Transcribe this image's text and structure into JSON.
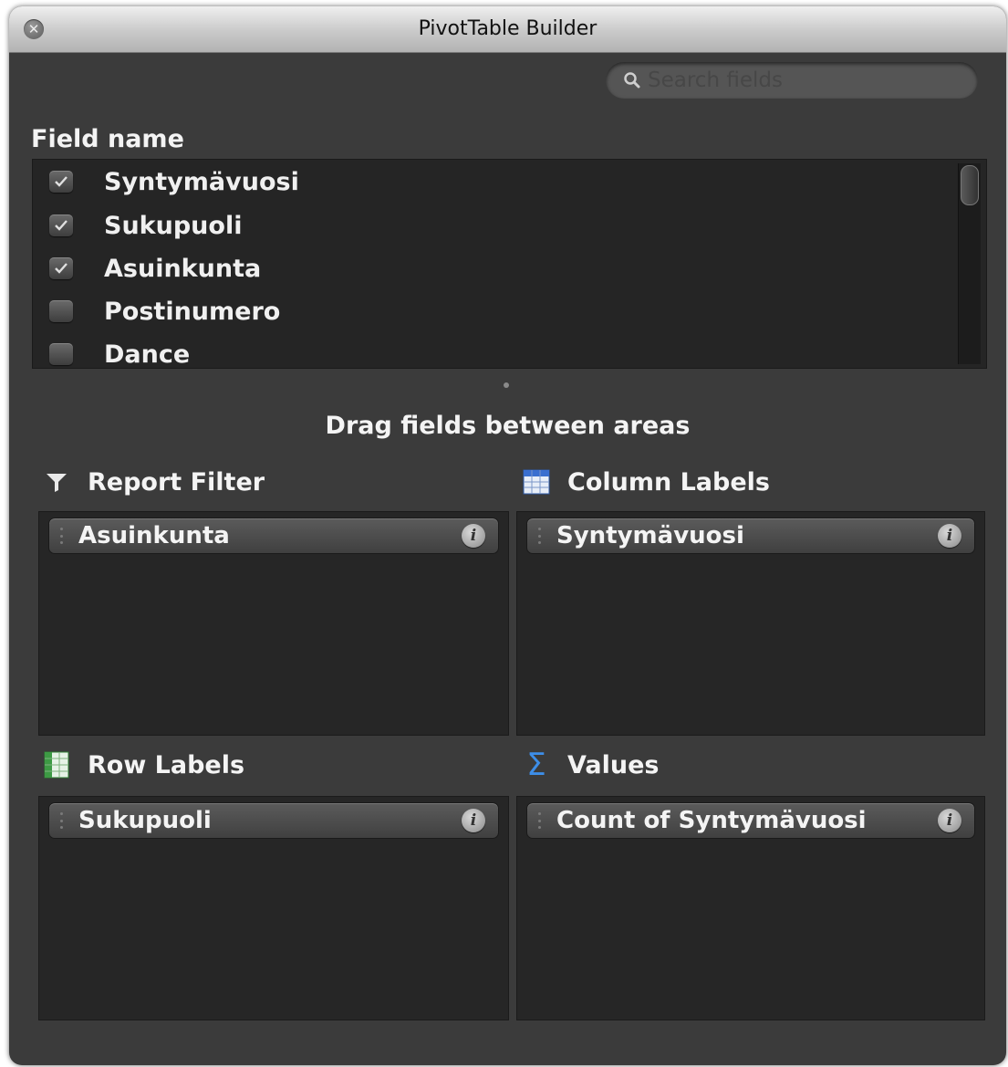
{
  "window": {
    "title": "PivotTable Builder",
    "close_icon": "close-icon"
  },
  "search": {
    "placeholder": "Search fields",
    "value": ""
  },
  "field_list": {
    "heading": "Field name",
    "items": [
      {
        "label": "Syntymävuosi",
        "checked": true
      },
      {
        "label": "Sukupuoli",
        "checked": true
      },
      {
        "label": "Asuinkunta",
        "checked": true
      },
      {
        "label": "Postinumero",
        "checked": false
      },
      {
        "label": "Dance",
        "checked": false
      }
    ]
  },
  "drag_heading": "Drag fields between areas",
  "areas": {
    "report_filter": {
      "label": "Report Filter",
      "icon": "filter-icon",
      "fields": [
        "Asuinkunta"
      ]
    },
    "column_labels": {
      "label": "Column Labels",
      "icon": "column-labels-icon",
      "fields": [
        "Syntymävuosi"
      ]
    },
    "row_labels": {
      "label": "Row Labels",
      "icon": "row-labels-icon",
      "fields": [
        "Sukupuoli"
      ]
    },
    "values": {
      "label": "Values",
      "icon": "sigma-icon",
      "fields": [
        "Count of Syntymävuosi"
      ]
    }
  },
  "colors": {
    "panel_bg": "#3b3b3b",
    "list_bg": "#252525",
    "text": "#f4f4f4",
    "sigma_blue": "#3d8ee8"
  }
}
